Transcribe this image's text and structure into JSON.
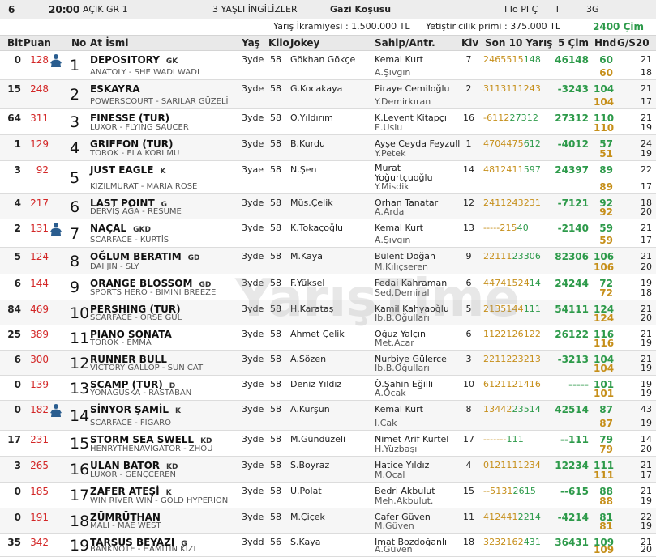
{
  "race": {
    "number": "6",
    "time": "20:00",
    "category": "AÇIK GR 1",
    "condition": "3 YAŞLI İNGİLİZLER",
    "name": "Gazi Koşusu",
    "codes": "I Io PI Ç",
    "track": "T",
    "grade": "3G",
    "prize": "Yarış İkramiyesi : 1.500.000 TL",
    "breeder_prize": "Yetiştiricilik primi : 375.000 TL",
    "distance": "2400 Çim"
  },
  "columns": {
    "blt": "Blt",
    "puan": "Puan",
    "no": "No",
    "name": "At İsmi",
    "yas": "Yaş",
    "kilo": "Kilo",
    "jokey": "Jokey",
    "sahip": "Sahip/Antr.",
    "klv": "Klv",
    "son10": "Son 10 Yarış",
    "cim5": "5 Çim",
    "hnd": "Hnd",
    "g20": "G/S20"
  },
  "watermark": "YarışTime",
  "colors": {
    "puan": "#d32626",
    "green": "#2d9a4a",
    "orange": "#c68f1a",
    "header": "#e9e9e9",
    "silk": "#2a5d8f"
  },
  "horses": [
    {
      "blt": "0",
      "puan": "128",
      "silk": true,
      "no": "1",
      "name": "DEPOSITORY",
      "eq": "GK",
      "ped": "ANATOLY - SHE WADI WADI",
      "yas": "3yde",
      "kilo": "58",
      "jokey": "Gökhan Gökçe",
      "sahip": "Kemal Kurt",
      "antr": "A.Şıvgın",
      "klv": "7",
      "son_o": "2465515",
      "son_g": "148",
      "cim5": "46148",
      "hnd1": "60",
      "hnd2": "60",
      "g1": "21",
      "g2": "18"
    },
    {
      "blt": "15",
      "puan": "248",
      "silk": false,
      "no": "2",
      "name": "ESKAYRA",
      "eq": "",
      "ped": "POWERSCOURT - SARILAR GÜZELİ",
      "yas": "3yde",
      "kilo": "58",
      "jokey": "G.Kocakaya",
      "sahip": "Piraye Cemiloğlu",
      "antr": "Y.Demirkıran",
      "klv": "2",
      "son_o": "3113111243",
      "son_g": "",
      "cim5": "-3243",
      "hnd1": "104",
      "hnd2": "104",
      "g1": "21",
      "g2": "17"
    },
    {
      "blt": "64",
      "puan": "311",
      "silk": false,
      "no": "3",
      "name": "FINESSE (TUR)",
      "eq": "",
      "ped": "LUXOR - FLYING SAUCER",
      "yas": "3yde",
      "kilo": "58",
      "jokey": "Ö.Yıldırım",
      "sahip": "K.Levent Kitapçı",
      "antr": "E.Uslu",
      "klv": "16",
      "son_o": "-6112",
      "son_g": "27312",
      "cim5": "27312",
      "hnd1": "110",
      "hnd2": "110",
      "g1": "21",
      "g2": "19"
    },
    {
      "blt": "1",
      "puan": "129",
      "silk": false,
      "no": "4",
      "name": "GRIFFON (TUR)",
      "eq": "",
      "ped": "TOROK - ELA KORI MU",
      "yas": "3yde",
      "kilo": "58",
      "jokey": "B.Kurdu",
      "sahip": "Ayşe Ceyda Feyzull",
      "antr": "Y.Petek",
      "klv": "1",
      "son_o": "4704475",
      "son_g": "612",
      "cim5": "-4012",
      "hnd1": "57",
      "hnd2": "51",
      "g1": "24",
      "g2": "19"
    },
    {
      "blt": "3",
      "puan": "92",
      "silk": false,
      "no": "5",
      "name": "JUST EAGLE",
      "eq": "K",
      "ped": "KIZILMURAT - MARIA ROSE",
      "yas": "3yae",
      "kilo": "58",
      "jokey": "N.Şen",
      "sahip": "Murat Yoğurtçuoğlu",
      "antr": "Y.Misdik",
      "klv": "14",
      "son_o": "4812411",
      "son_g": "597",
      "cim5": "24397",
      "hnd1": "89",
      "hnd2": "89",
      "g1": "22",
      "g2": "17"
    },
    {
      "blt": "4",
      "puan": "217",
      "silk": false,
      "no": "6",
      "name": "LAST POINT",
      "eq": "G",
      "ped": "DERVİŞ AĞA - RESUME",
      "yas": "3yde",
      "kilo": "58",
      "jokey": "Müs.Çelik",
      "sahip": "Orhan Tanatar",
      "antr": "A.Arda",
      "klv": "12",
      "son_o": "2411243231",
      "son_g": "",
      "cim5": "-7121",
      "hnd1": "92",
      "hnd2": "92",
      "g1": "18",
      "g2": "20"
    },
    {
      "blt": "2",
      "puan": "131",
      "silk": true,
      "no": "7",
      "name": "NAÇAL",
      "eq": "GKD",
      "ped": "SCARFACE - KURTİS",
      "yas": "3yde",
      "kilo": "58",
      "jokey": "K.Tokaçoğlu",
      "sahip": "Kemal Kurt",
      "antr": "A.Şıvgın",
      "klv": "13",
      "son_o": "-----215",
      "son_g": "40",
      "cim5": "-2140",
      "hnd1": "59",
      "hnd2": "59",
      "g1": "21",
      "g2": "17"
    },
    {
      "blt": "5",
      "puan": "124",
      "silk": false,
      "no": "8",
      "name": "OĞLUM BERATIM",
      "eq": "GD",
      "ped": "DAI JIN - SLY",
      "yas": "3yde",
      "kilo": "58",
      "jokey": "M.Kaya",
      "sahip": "Bülent Doğan",
      "antr": "M.Kılıçseren",
      "klv": "9",
      "son_o": "22111",
      "son_g": "23306",
      "cim5": "82306",
      "hnd1": "106",
      "hnd2": "106",
      "g1": "21",
      "g2": "20"
    },
    {
      "blt": "6",
      "puan": "144",
      "silk": false,
      "no": "9",
      "name": "ORANGE BLOSSOM",
      "eq": "GD",
      "ped": "SPORTS HERO - BIMINI BREEZE",
      "yas": "3yde",
      "kilo": "58",
      "jokey": "F.Yüksel",
      "sahip": "Fedai Kahraman",
      "antr": "Sed.Demiral",
      "klv": "6",
      "son_o": "44741524",
      "son_g": "14",
      "cim5": "24244",
      "hnd1": "72",
      "hnd2": "72",
      "g1": "19",
      "g2": "18"
    },
    {
      "blt": "84",
      "puan": "469",
      "silk": false,
      "no": "10",
      "name": "PERSHING (TUR)",
      "eq": "",
      "ped": "SCARFACE - ORSE GÜL",
      "yas": "3yde",
      "kilo": "58",
      "jokey": "H.Karataş",
      "sahip": "Kamil Kahyaoğlu",
      "antr": "Ib.B.Oğulları",
      "klv": "5",
      "son_o": "2135144",
      "son_g": "111",
      "cim5": "54111",
      "hnd1": "124",
      "hnd2": "124",
      "g1": "21",
      "g2": "20"
    },
    {
      "blt": "25",
      "puan": "389",
      "silk": false,
      "no": "11",
      "name": "PIANO SONATA",
      "eq": "",
      "ped": "TOROK - EMMA",
      "yas": "3yde",
      "kilo": "58",
      "jokey": "Ahmet Çelik",
      "sahip": "Oğuz Yalçın",
      "antr": "Met.Acar",
      "klv": "6",
      "son_o": "1122126122",
      "son_g": "",
      "cim5": "26122",
      "hnd1": "116",
      "hnd2": "116",
      "g1": "21",
      "g2": "19"
    },
    {
      "blt": "6",
      "puan": "300",
      "silk": false,
      "no": "12",
      "name": "RUNNER BULL",
      "eq": "",
      "ped": "VICTORY GALLOP - SUN CAT",
      "yas": "3yde",
      "kilo": "58",
      "jokey": "A.Sözen",
      "sahip": "Nurbiye Gülerce",
      "antr": "Ib.B.Oğulları",
      "klv": "3",
      "son_o": "2211223213",
      "son_g": "",
      "cim5": "-3213",
      "hnd1": "104",
      "hnd2": "104",
      "g1": "21",
      "g2": "19"
    },
    {
      "blt": "0",
      "puan": "139",
      "silk": false,
      "no": "13",
      "name": "SCAMP (TUR)",
      "eq": "D",
      "ped": "YONAGUSKA - RASTABAN",
      "yas": "3yde",
      "kilo": "58",
      "jokey": "Deniz Yıldız",
      "sahip": "Ö.Şahin Eğilli",
      "antr": "A.Ocak",
      "klv": "10",
      "son_o": "6121121416",
      "son_g": "",
      "cim5": "-----",
      "hnd1": "101",
      "hnd2": "101",
      "g1": "19",
      "g2": "19"
    },
    {
      "blt": "0",
      "puan": "182",
      "silk": true,
      "no": "14",
      "name": "SİNYOR ŞAMİL",
      "eq": "K",
      "ped": "SCARFACE - FIGARO",
      "yas": "3yde",
      "kilo": "58",
      "jokey": "A.Kurşun",
      "sahip": "Kemal Kurt",
      "antr": "I.Çak",
      "klv": "8",
      "son_o": "13442",
      "son_g": "23514",
      "cim5": "42514",
      "hnd1": "87",
      "hnd2": "87",
      "g1": "43",
      "g2": "19"
    },
    {
      "blt": "17",
      "puan": "231",
      "silk": false,
      "no": "15",
      "name": "STORM SEA SWELL",
      "eq": "KD",
      "ped": "HENRYTHENAVIGATOR - ZHOU",
      "yas": "3yde",
      "kilo": "58",
      "jokey": "M.Gündüzeli",
      "sahip": "Nimet Arif Kurtel",
      "antr": "H.Yüzbaşı",
      "klv": "17",
      "son_o": "-------",
      "son_g": "111",
      "cim5": "--111",
      "hnd1": "79",
      "hnd2": "79",
      "g1": "14",
      "g2": "20"
    },
    {
      "blt": "3",
      "puan": "265",
      "silk": false,
      "no": "16",
      "name": "ULAN BATOR",
      "eq": "KD",
      "ped": "LUXOR - GENÇCEREN",
      "yas": "3yde",
      "kilo": "58",
      "jokey": "S.Boyraz",
      "sahip": "Hatice Yıldız",
      "antr": "M.Öcal",
      "klv": "4",
      "son_o": "0121111234",
      "son_g": "",
      "cim5": "12234",
      "hnd1": "111",
      "hnd2": "111",
      "g1": "21",
      "g2": "17"
    },
    {
      "blt": "0",
      "puan": "185",
      "silk": false,
      "no": "17",
      "name": "ZAFER ATEŞİ",
      "eq": "K",
      "ped": "WIN RIVER WIN - GOLD HYPERION",
      "yas": "3yde",
      "kilo": "58",
      "jokey": "U.Polat",
      "sahip": "Bedri Akbulut",
      "antr": "Meh.Akbulut.",
      "klv": "15",
      "son_o": "--5131",
      "son_g": "2615",
      "cim5": "--615",
      "hnd1": "88",
      "hnd2": "88",
      "g1": "21",
      "g2": "19"
    },
    {
      "blt": "0",
      "puan": "191",
      "silk": false,
      "no": "18",
      "name": "ZÜMRÜTHAN",
      "eq": "",
      "ped": "MALİ - MAE WEST",
      "yas": "3yde",
      "kilo": "58",
      "jokey": "M.Çiçek",
      "sahip": "Cafer Güven",
      "antr": "M.Güven",
      "klv": "11",
      "son_o": "412441",
      "son_g": "2214",
      "cim5": "-4214",
      "hnd1": "81",
      "hnd2": "81",
      "g1": "22",
      "g2": "19"
    },
    {
      "blt": "35",
      "puan": "342",
      "silk": false,
      "no": "19",
      "name": "TARSUS BEYAZI",
      "eq": "G",
      "ped": "BANKNOTE - HAMİTİN KIZI",
      "yas": "3ydd",
      "kilo": "56",
      "jokey": "S.Kaya",
      "sahip": "Imat Bozdoğanlı",
      "antr": "A.Güven",
      "klv": "18",
      "son_o": "3232162",
      "son_g": "431",
      "cim5": "36431",
      "hnd1": "109",
      "hnd2": "109",
      "g1": "21",
      "g2": "20"
    }
  ]
}
